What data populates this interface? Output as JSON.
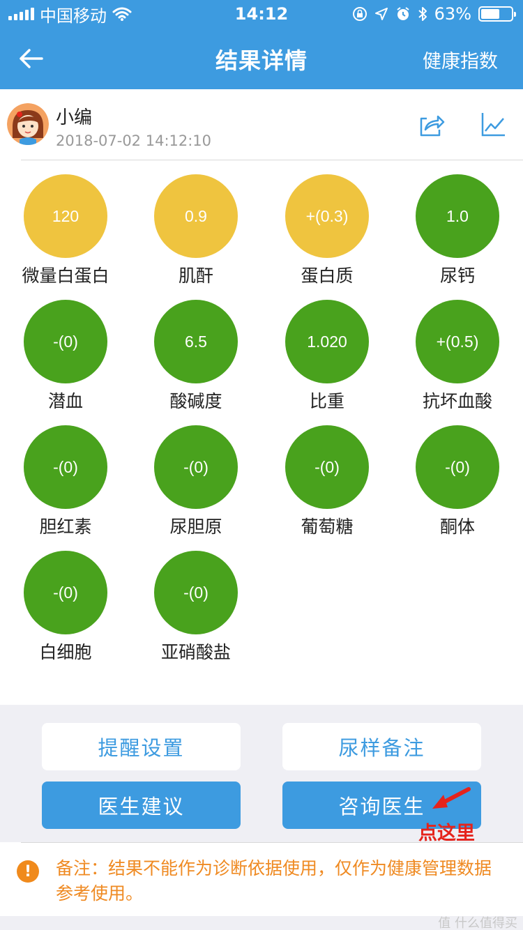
{
  "status": {
    "carrier": "中国移动",
    "time": "14:12",
    "battery": "63%",
    "battery_level": 0.63
  },
  "nav": {
    "title": "结果详情",
    "right_label": "健康指数"
  },
  "user": {
    "name": "小编",
    "datetime": "2018-07-02 14:12:10"
  },
  "colors": {
    "brand_blue": "#3d9be0",
    "abnormal_yellow": "#efc43f",
    "normal_green": "#49a21d",
    "note_orange": "#ef8a22",
    "hint_red": "#e5231b"
  },
  "results": [
    {
      "value": "120",
      "label": "微量白蛋白",
      "status": "yellow"
    },
    {
      "value": "0.9",
      "label": "肌酐",
      "status": "yellow"
    },
    {
      "value": "+(0.3)",
      "label": "蛋白质",
      "status": "yellow"
    },
    {
      "value": "1.0",
      "label": "尿钙",
      "status": "green"
    },
    {
      "value": "-(0)",
      "label": "潜血",
      "status": "green"
    },
    {
      "value": "6.5",
      "label": "酸碱度",
      "status": "green"
    },
    {
      "value": "1.020",
      "label": "比重",
      "status": "green"
    },
    {
      "value": "+(0.5)",
      "label": "抗坏血酸",
      "status": "green"
    },
    {
      "value": "-(0)",
      "label": "胆红素",
      "status": "green"
    },
    {
      "value": "-(0)",
      "label": "尿胆原",
      "status": "green"
    },
    {
      "value": "-(0)",
      "label": "葡萄糖",
      "status": "green"
    },
    {
      "value": "-(0)",
      "label": "酮体",
      "status": "green"
    },
    {
      "value": "-(0)",
      "label": "白细胞",
      "status": "green"
    },
    {
      "value": "-(0)",
      "label": "亚硝酸盐",
      "status": "green"
    }
  ],
  "actions": {
    "reminder_settings": "提醒设置",
    "sample_note": "尿样备注",
    "doctor_advice": "医生建议",
    "consult_doctor": "咨询医生",
    "hint": "点这里"
  },
  "note": {
    "text": "备注：结果不能作为诊断依据使用，仅作为健康管理数据参考使用。"
  },
  "watermark": "值 什么值得买"
}
